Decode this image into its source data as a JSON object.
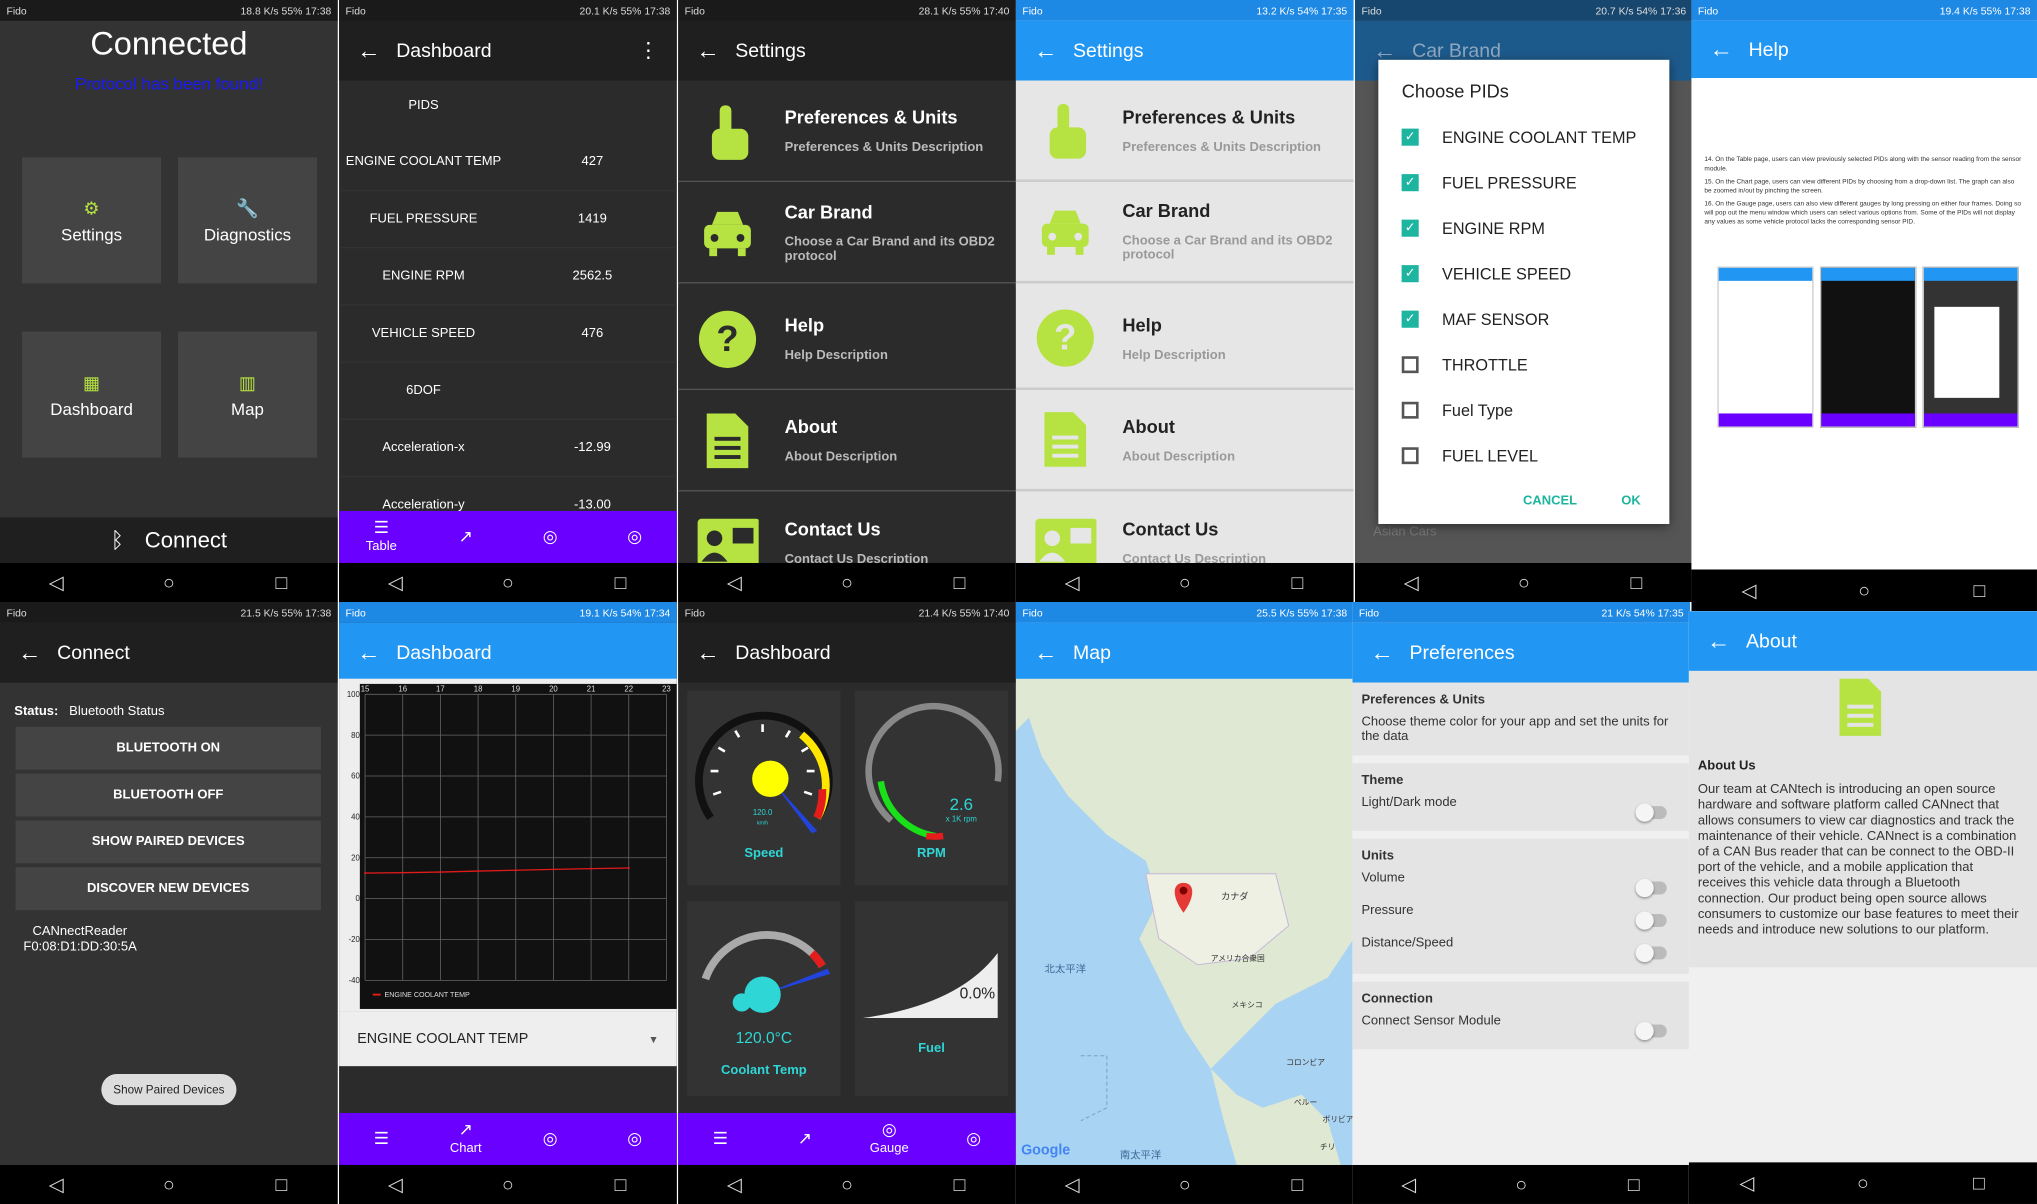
{
  "status": {
    "carrier": "Fido",
    "p1": "18.8 K/s",
    "p1b": "55%",
    "p1t": "17:38",
    "p2": "20.1 K/s",
    "p2b": "55%",
    "p2t": "17:38",
    "p3": "28.1 K/s",
    "p3b": "55%",
    "p3t": "17:40",
    "p4": "13.2 K/s",
    "p4b": "54%",
    "p4t": "17:35",
    "p5": "20.7 K/s",
    "p5b": "54%",
    "p5t": "17:36",
    "p6": "19.4 K/s",
    "p6b": "55%",
    "p6t": "17:38",
    "p7": "21.5 K/s",
    "p7b": "55%",
    "p7t": "17:38",
    "p8": "19.1 K/s",
    "p8b": "54%",
    "p8t": "17:34",
    "p9": "21.4 K/s",
    "p9b": "55%",
    "p9t": "17:40",
    "p10": "25.5 K/s",
    "p10b": "55%",
    "p10t": "17:38",
    "p11": "21 K/s",
    "p11b": "54%",
    "p11t": "17:35"
  },
  "home": {
    "title": "Connected",
    "subtitle": "Protocol has been found!",
    "tiles": [
      "Settings",
      "Diagnostics",
      "Dashboard",
      "Map"
    ],
    "connect": "Connect"
  },
  "table": {
    "title": "Dashboard",
    "header": "PIDS",
    "rows": [
      {
        "k": "ENGINE COOLANT TEMP",
        "v": "427"
      },
      {
        "k": "FUEL PRESSURE",
        "v": "1419"
      },
      {
        "k": "ENGINE RPM",
        "v": "2562.5"
      },
      {
        "k": "VEHICLE SPEED",
        "v": "476"
      },
      {
        "k": "6DOF",
        "v": ""
      },
      {
        "k": "Acceleration-x",
        "v": "-12.99"
      },
      {
        "k": "Acceleration-y",
        "v": "-13.00"
      }
    ],
    "tab": "Table"
  },
  "settings": {
    "title": "Settings",
    "items": [
      {
        "t": "Preferences & Units",
        "d": "Preferences & Units Description"
      },
      {
        "t": "Car Brand",
        "d": "Choose a Car Brand and its OBD2 protocol"
      },
      {
        "t": "Help",
        "d": "Help Description"
      },
      {
        "t": "About",
        "d": "About Description"
      },
      {
        "t": "Contact Us",
        "d": "Contact Us Description"
      }
    ]
  },
  "pids": {
    "bgtitle": "Car Brand",
    "bgfoot": "Asian Cars",
    "title": "Choose PIDs",
    "items": [
      {
        "l": "ENGINE COOLANT TEMP",
        "on": true
      },
      {
        "l": "FUEL PRESSURE",
        "on": true
      },
      {
        "l": "ENGINE RPM",
        "on": true
      },
      {
        "l": "VEHICLE SPEED",
        "on": true
      },
      {
        "l": "MAF SENSOR",
        "on": true
      },
      {
        "l": "THROTTLE",
        "on": false
      },
      {
        "l": "Fuel Type",
        "on": false
      },
      {
        "l": "FUEL LEVEL",
        "on": false
      }
    ],
    "cancel": "CANCEL",
    "ok": "OK"
  },
  "help": {
    "title": "Help",
    "p14": "14. On the Table page, users can view previously selected PIDs along with the sensor reading from the sensor module.",
    "p15": "15. On the Chart page, users can view different PIDs by choosing from a drop-down list. The graph can also be zoomed in/out by pinching the screen.",
    "p16": "16. On the Gauge page, users can also view different gauges by long pressing on either four frames. Doing so will pop out the menu window which users can select various options from. Some of the PIDs will not display any values as some vehicle protocol lacks the corresponding sensor PID."
  },
  "connect": {
    "title": "Connect",
    "status_label": "Status:",
    "status_value": "Bluetooth Status",
    "buttons": [
      "BLUETOOTH ON",
      "BLUETOOTH OFF",
      "SHOW PAIRED DEVICES",
      "DISCOVER NEW DEVICES"
    ],
    "device_name": "CANnectReader",
    "device_addr": "F0:08:D1:DD:30:5A",
    "toast": "Show Paired Devices"
  },
  "chart": {
    "title": "Dashboard",
    "select": "ENGINE COOLANT TEMP",
    "tab": "Chart"
  },
  "chart_data": {
    "type": "line",
    "x": [
      15,
      16,
      17,
      18,
      19,
      20,
      21,
      22,
      23
    ],
    "ylim": [
      -40,
      100
    ],
    "yticks": [
      100,
      80,
      60,
      40,
      20,
      0,
      -20,
      -40
    ],
    "series": [
      {
        "name": "ENGINE COOLANT TEMP",
        "x": [
          15,
          16,
          17,
          18,
          19,
          20,
          21,
          22
        ],
        "values": [
          12.5,
          12.7,
          13.0,
          13.5,
          13.9,
          14.3,
          14.7,
          15.0
        ]
      }
    ]
  },
  "gauge": {
    "title": "Dashboard",
    "speed_label": "Speed",
    "speed_value": "120.0",
    "speed_unit": "km/h",
    "rpm_label": "RPM",
    "rpm_value": "2.6",
    "rpm_unit": "x 1K rpm",
    "coolant_label": "Coolant Temp",
    "coolant_value": "120.0°C",
    "fuel_label": "Fuel",
    "fuel_value": "0.0%",
    "tab": "Gauge"
  },
  "map": {
    "title": "Map",
    "labels": [
      "カナダ",
      "北太平洋",
      "アメリカ合衆国",
      "メキシコ",
      "南太平洋",
      "コロンビア",
      "ペルー",
      "ボリビア",
      "チリ"
    ],
    "google": "Google"
  },
  "prefs": {
    "title": "Preferences",
    "sec1_h": "Preferences & Units",
    "sec1_d": "Choose theme color for your app and set the units for the data",
    "theme_h": "Theme",
    "theme_item": "Light/Dark mode",
    "units_h": "Units",
    "units_items": [
      "Volume",
      "Pressure",
      "Distance/Speed"
    ],
    "conn_h": "Connection",
    "conn_item": "Connect Sensor Module"
  },
  "about": {
    "title": "About",
    "heading": "About Us",
    "body": "Our team at CANtech is introducing an open source hardware and software platform called CANnect that allows consumers to view car diagnostics and track the maintenance of their vehicle. CANnect is a combination of a CAN Bus reader that can be connect to the OBD-II port of the vehicle, and a mobile application that receives this vehicle data through a Bluetooth connection. Our product being open source allows consumers to customize our base features to meet their needs and introduce new solutions to our platform."
  },
  "colors": {
    "accent": "#b6e341",
    "blue": "#2196f3",
    "purple": "#6a00ff",
    "teal": "#1eb5a0"
  }
}
